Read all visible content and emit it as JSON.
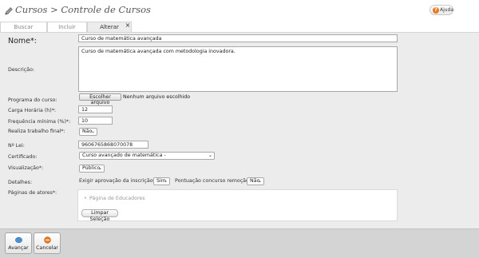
{
  "header": {
    "title": "Cursos > Controle de Cursos",
    "help_label": "Ajuda"
  },
  "tabs": [
    {
      "label": "Buscar",
      "active": false
    },
    {
      "label": "Incluir",
      "active": false
    },
    {
      "label": "Alterar",
      "active": true
    }
  ],
  "tab_close_glyph": "×",
  "form": {
    "nome": {
      "label": "Nome*:",
      "value": "Curso de matemática avançada"
    },
    "descricao": {
      "label": "Descrição:",
      "value": "Curso de matemática avançada com metodologia inovadora."
    },
    "programa": {
      "label": "Programa do curso:",
      "button": "Escolher arquivo",
      "status": "Nenhum arquivo escolhido"
    },
    "carga_horaria": {
      "label": "Carga Horária (h)*:",
      "value": "12"
    },
    "frequencia": {
      "label": "Frequência mínima (%)*:",
      "value": "10"
    },
    "trabalho_final": {
      "label": "Realiza trabalho final*:",
      "value": "Não"
    },
    "lei": {
      "label": "Nº Lei:",
      "value": "9606765868070078"
    },
    "certificado": {
      "label": "Certificado:",
      "value": "Curso avançado de matemática -"
    },
    "visualizacao": {
      "label": "Visualização*:",
      "value": "Público"
    },
    "detalhes": {
      "label": "Detalhes:",
      "aprovacao_label": "Exigir aprovação da inscrição*:",
      "aprovacao_value": "Sim",
      "pontuacao_label": "Pontuação concurso remoção*:",
      "pontuacao_value": "Não"
    },
    "atores": {
      "label": "Páginas de atores*:",
      "items": [
        "Página de Educadores"
      ],
      "clear_button": "Limpar Seleção"
    }
  },
  "footer": {
    "advance_label": "Avançar",
    "cancel_label": "Cancelar"
  },
  "colors": {
    "panel_bg": "#ececec",
    "footer_bg": "#d4d4d4",
    "help_icon": "#e87a1e",
    "advance_icon": "#4a8fd4",
    "cancel_icon": "#e87a1e"
  },
  "icons": {
    "title": "pencil-icon",
    "help": "help-icon",
    "advance": "advance-icon",
    "cancel": "cancel-icon",
    "dropdown": "chevron-down-icon"
  }
}
